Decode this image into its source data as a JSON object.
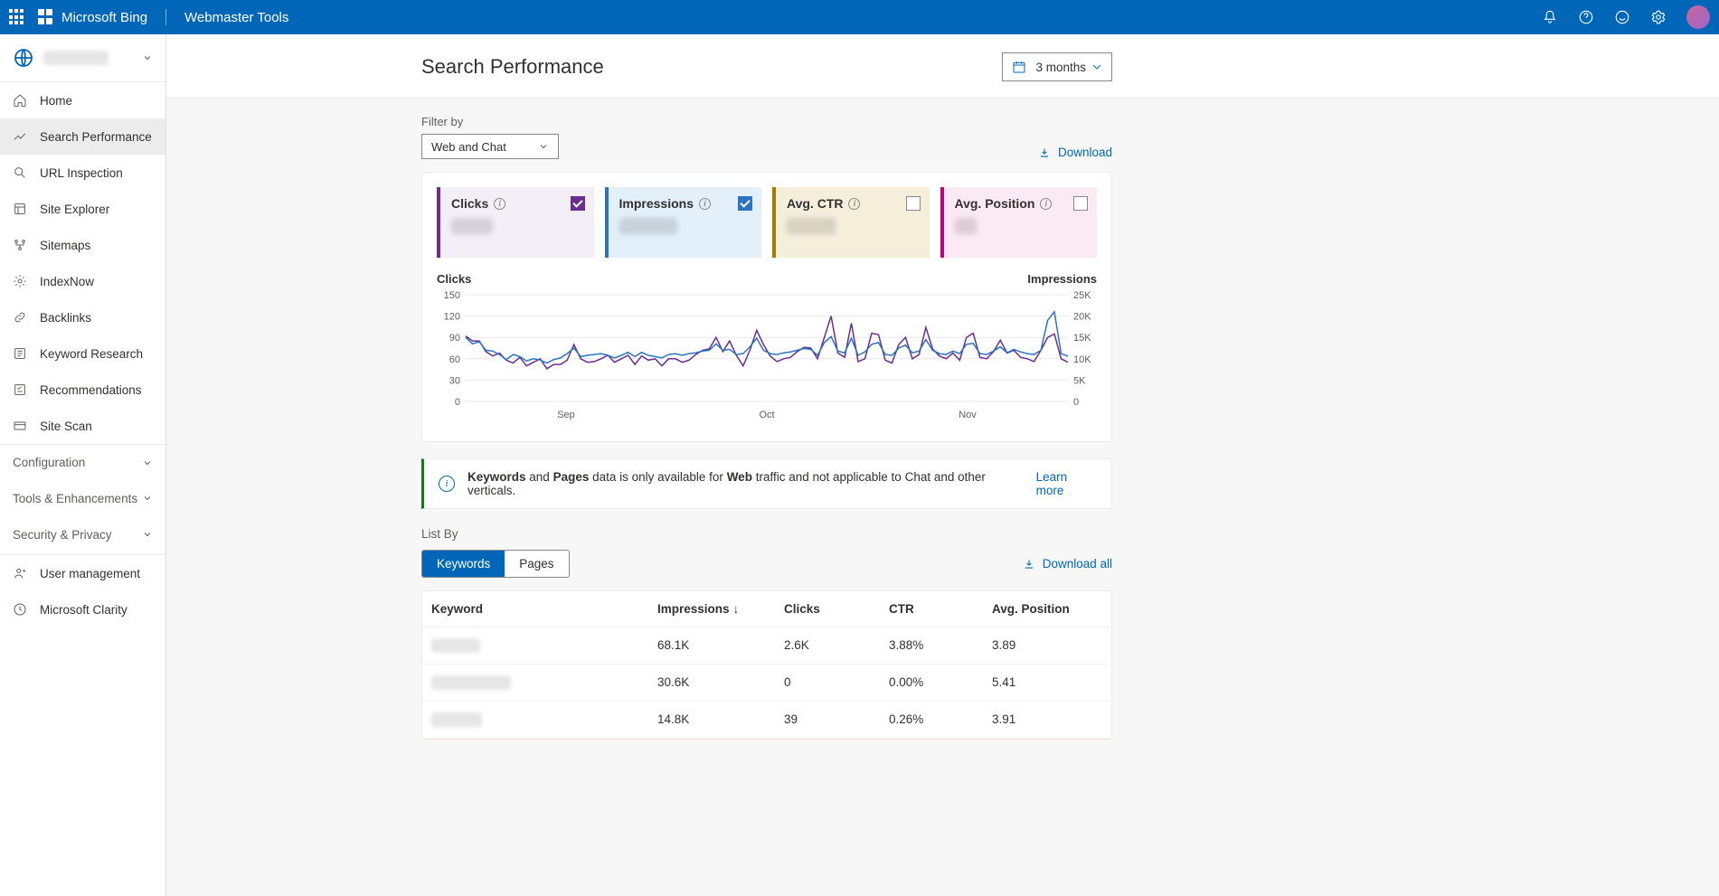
{
  "header": {
    "brand1": "Microsoft Bing",
    "brand2": "Webmaster Tools"
  },
  "sidebar": {
    "items": [
      {
        "label": "Home"
      },
      {
        "label": "Search Performance"
      },
      {
        "label": "URL Inspection"
      },
      {
        "label": "Site Explorer"
      },
      {
        "label": "Sitemaps"
      },
      {
        "label": "IndexNow"
      },
      {
        "label": "Backlinks"
      },
      {
        "label": "Keyword Research"
      },
      {
        "label": "Recommendations"
      },
      {
        "label": "Site Scan"
      }
    ],
    "groups": [
      {
        "label": "Configuration"
      },
      {
        "label": "Tools & Enhancements"
      },
      {
        "label": "Security & Privacy"
      }
    ],
    "bottom": [
      {
        "label": "User management"
      },
      {
        "label": "Microsoft Clarity"
      }
    ]
  },
  "page": {
    "title": "Search Performance",
    "date_range": "3 months",
    "filter_label": "Filter by",
    "filter_value": "Web and Chat",
    "download": "Download",
    "download_all": "Download all",
    "list_by": "List By"
  },
  "metrics": {
    "clicks_label": "Clicks",
    "impressions_label": "Impressions",
    "ctr_label": "Avg. CTR",
    "pos_label": "Avg. Position"
  },
  "chart_data": {
    "type": "line",
    "left_axis_label": "Clicks",
    "right_axis_label": "Impressions",
    "left_ticks": [
      0,
      30,
      60,
      90,
      120,
      150
    ],
    "right_ticks": [
      "0",
      "5K",
      "10K",
      "15K",
      "20K",
      "25K"
    ],
    "x_ticks": [
      "Sep",
      "Oct",
      "Nov"
    ],
    "xlim": [
      0,
      90
    ],
    "left_ylim": [
      0,
      150
    ],
    "right_ylim": [
      0,
      25000
    ],
    "series": [
      {
        "name": "Clicks",
        "color": "#6b2d90",
        "axis": "left",
        "values": [
          92,
          85,
          85,
          70,
          64,
          68,
          58,
          54,
          62,
          50,
          55,
          60,
          46,
          52,
          52,
          58,
          80,
          60,
          55,
          56,
          60,
          65,
          55,
          60,
          65,
          52,
          64,
          58,
          60,
          50,
          60,
          60,
          55,
          58,
          66,
          72,
          74,
          90,
          70,
          85,
          65,
          50,
          72,
          100,
          80,
          64,
          56,
          60,
          62,
          70,
          76,
          75,
          60,
          90,
          120,
          68,
          62,
          110,
          56,
          60,
          96,
          94,
          58,
          54,
          80,
          90,
          60,
          66,
          104,
          74,
          64,
          60,
          68,
          58,
          90,
          96,
          62,
          60,
          70,
          86,
          68,
          72,
          62,
          60,
          56,
          72,
          90,
          95,
          60,
          55
        ]
      },
      {
        "name": "Impressions",
        "color": "#2b74c2",
        "axis": "right",
        "values": [
          15000,
          13500,
          14000,
          12000,
          11800,
          11000,
          9800,
          11000,
          10500,
          9500,
          10000,
          9700,
          9000,
          9800,
          10200,
          11200,
          12500,
          10500,
          10800,
          11000,
          11200,
          10800,
          10200,
          10800,
          11500,
          10500,
          11500,
          10800,
          10500,
          10200,
          11000,
          11200,
          10800,
          11200,
          11400,
          11800,
          12000,
          13500,
          12000,
          12200,
          11000,
          11200,
          12800,
          14800,
          12000,
          11200,
          11000,
          11400,
          11600,
          12000,
          12400,
          12200,
          10800,
          13800,
          15200,
          11800,
          11400,
          14800,
          10800,
          11600,
          13400,
          13800,
          11000,
          10800,
          12500,
          13200,
          11400,
          11800,
          14500,
          12000,
          11200,
          11000,
          11800,
          11200,
          13400,
          13600,
          11200,
          11000,
          11800,
          12800,
          11400,
          12200,
          11600,
          11200,
          11000,
          12000,
          19000,
          21000,
          11200,
          10600
        ]
      }
    ]
  },
  "banner": {
    "kw": "Keywords",
    "and": " and ",
    "pages": "Pages",
    "mid": " data is only available for ",
    "web": "Web",
    "tail": " traffic and not applicable to Chat and other verticals.",
    "learn_more": "Learn more"
  },
  "listby": {
    "keywords": "Keywords",
    "pages": "Pages"
  },
  "table": {
    "cols": {
      "keyword": "Keyword",
      "impressions": "Impressions",
      "clicks": "Clicks",
      "ctr": "CTR",
      "pos": "Avg. Position"
    },
    "rows": [
      {
        "kw_blur_w": 54,
        "impressions": "68.1K",
        "clicks": "2.6K",
        "ctr": "3.88%",
        "pos": "3.89"
      },
      {
        "kw_blur_w": 88,
        "impressions": "30.6K",
        "clicks": "0",
        "ctr": "0.00%",
        "pos": "5.41"
      },
      {
        "kw_blur_w": 56,
        "impressions": "14.8K",
        "clicks": "39",
        "ctr": "0.26%",
        "pos": "3.91"
      }
    ]
  }
}
